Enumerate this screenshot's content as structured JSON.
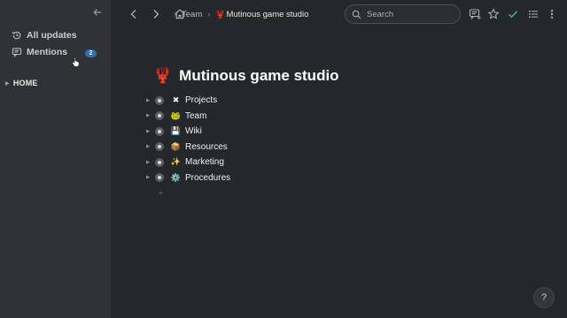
{
  "sidebar": {
    "items": [
      {
        "label": "All updates",
        "icon": "history-icon"
      },
      {
        "label": "Mentions",
        "icon": "comment-icon",
        "badge": "2"
      }
    ],
    "section": "HOME"
  },
  "topbar": {
    "breadcrumb": {
      "root": "Team",
      "page_emoji": "🦞",
      "page": "Mutinous game studio"
    },
    "search_placeholder": "Search"
  },
  "page": {
    "title_emoji": "🦞",
    "title": "Mutinous game studio",
    "children": [
      {
        "emoji": "✖",
        "label": "Projects"
      },
      {
        "emoji": "🐸",
        "label": "Team"
      },
      {
        "emoji": "💾",
        "label": "Wiki"
      },
      {
        "emoji": "📦",
        "label": "Resources"
      },
      {
        "emoji": "✨",
        "label": "Marketing"
      },
      {
        "emoji": "⚙️",
        "label": "Procedures"
      }
    ],
    "add_symbol": "+"
  },
  "help_label": "?",
  "colors": {
    "accent_check": "#4caf7d",
    "badge": "#2f6fb0",
    "background": "#25282b",
    "sidebar": "#2f3336"
  }
}
